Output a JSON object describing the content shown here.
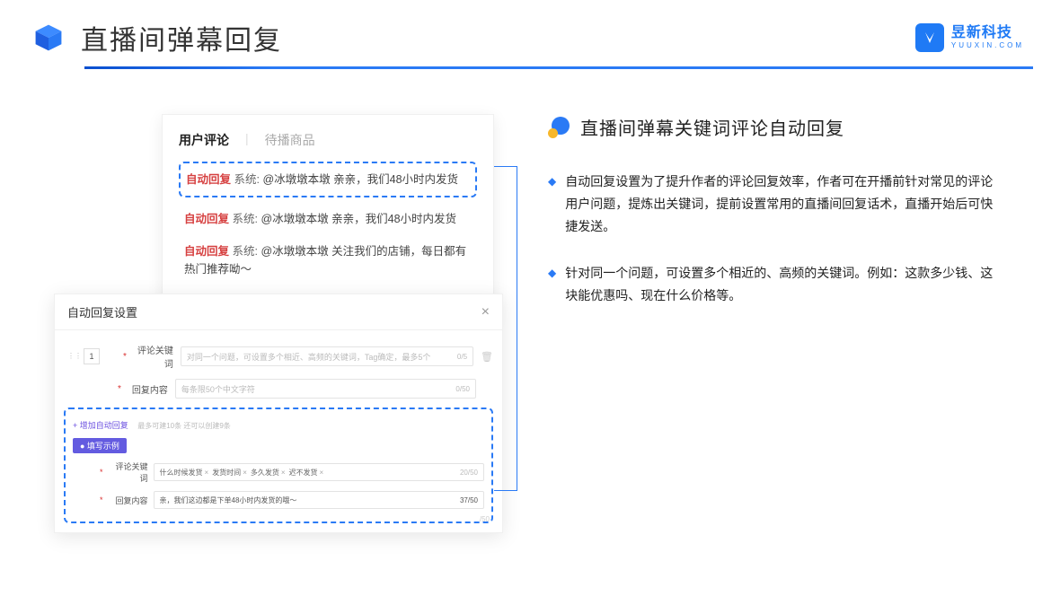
{
  "header": {
    "page_title": "直播间弹幕回复",
    "brand_name": "昱新科技",
    "brand_sub": "YUUXIN.COM"
  },
  "comments_panel": {
    "tab_active": "用户评论",
    "tab_inactive": "待播商品",
    "reply_label": "自动回复",
    "system_label": "系统:",
    "items": [
      "@冰墩墩本墩 亲亲，我们48小时内发货",
      "@冰墩墩本墩 亲亲，我们48小时内发货",
      "@冰墩墩本墩 关注我们的店铺，每日都有热门推荐呦～"
    ]
  },
  "settings_panel": {
    "title": "自动回复设置",
    "row_num": "1",
    "label_keyword": "评论关键词",
    "placeholder_keyword": "对同一个问题，可设置多个相近、高频的关键词，Tag确定，最多5个",
    "count_keyword": "0/5",
    "label_reply": "回复内容",
    "placeholder_reply": "每条限50个中文字符",
    "count_reply": "0/50",
    "add_link": "+ 增加自动回复",
    "add_note": "最多可建10条 还可以创建9条",
    "example_badge": "● 填写示例",
    "example_keyword_label": "评论关键词",
    "example_tags": [
      "什么时候发货",
      "发货时间",
      "多久发货",
      "迟不发货"
    ],
    "example_keyword_count": "20/50",
    "example_reply_label": "回复内容",
    "example_reply_value": "亲，我们这边都是下单48小时内发货的哦～",
    "example_reply_count": "37/50",
    "stray_count": "/50"
  },
  "right": {
    "section_title": "直播间弹幕关键词评论自动回复",
    "bullets": [
      "自动回复设置为了提升作者的评论回复效率，作者可在开播前针对常见的评论用户问题，提炼出关键词，提前设置常用的直播间回复话术，直播开始后可快捷发送。",
      "针对同一个问题，可设置多个相近的、高频的关键词。例如：这款多少钱、这块能优惠吗、现在什么价格等。"
    ]
  }
}
